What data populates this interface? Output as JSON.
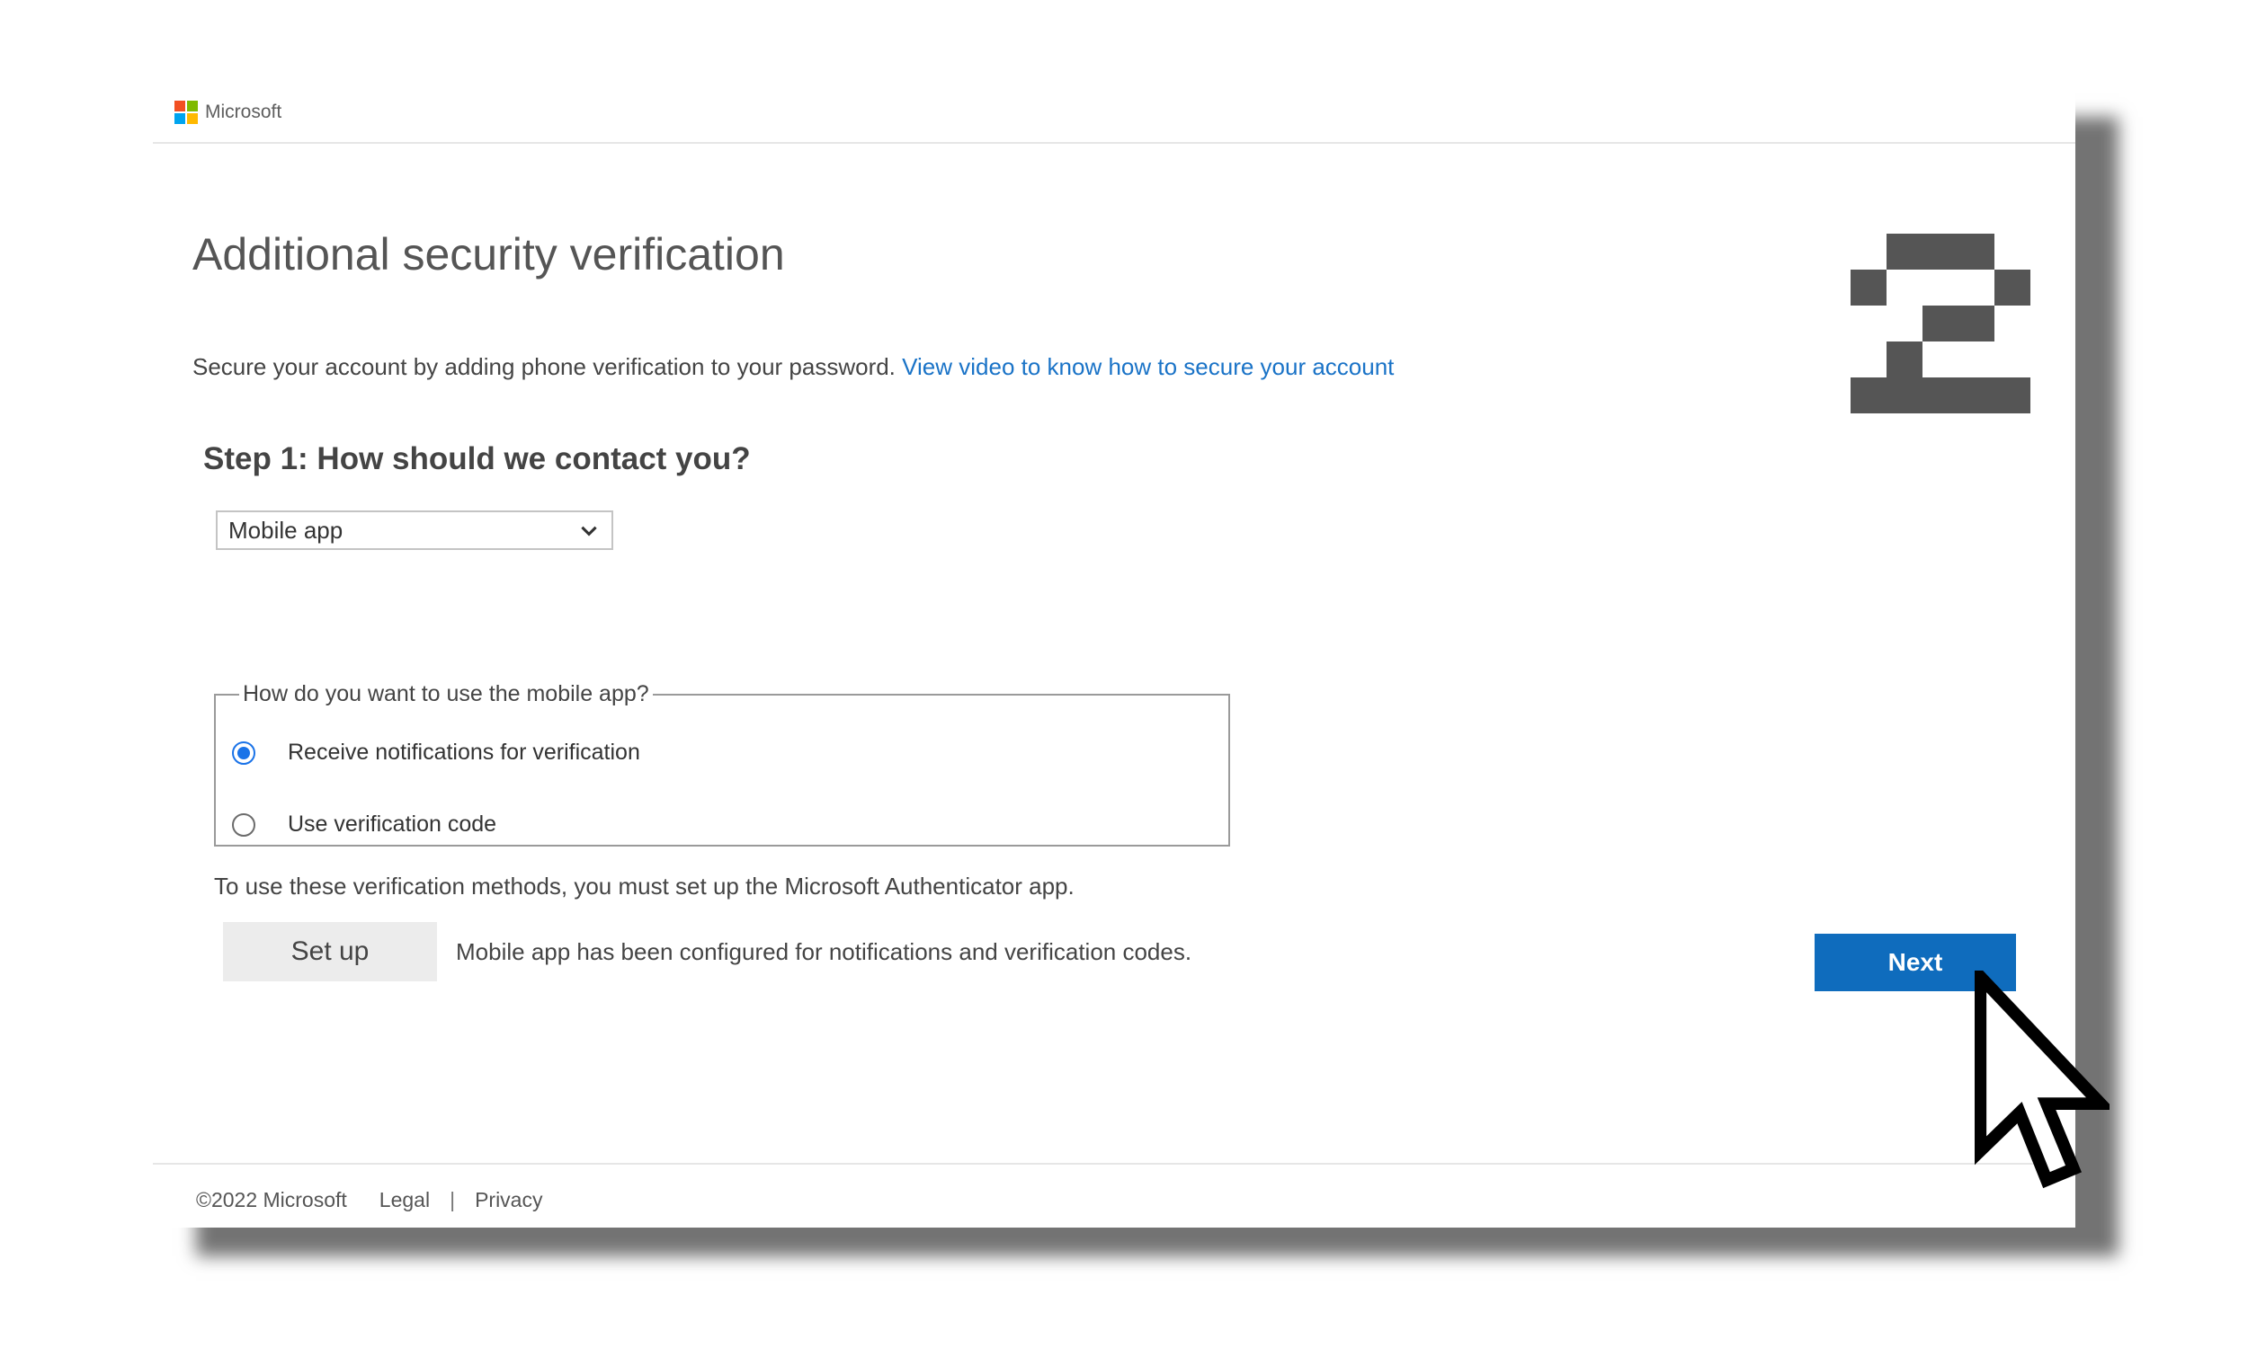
{
  "header": {
    "brand": "Microsoft",
    "logo_colors": [
      "#f25022",
      "#7fba00",
      "#00a4ef",
      "#ffb900"
    ]
  },
  "badge": {
    "number": "2"
  },
  "page": {
    "title": "Additional security verification",
    "intro_text": "Secure your account by adding phone verification to your password. ",
    "intro_link": "View video to know how to secure your account"
  },
  "step": {
    "title": "Step 1: How should we contact you?",
    "method_select": {
      "value": "Mobile app"
    }
  },
  "mobile_app": {
    "legend": "How do you want to use the mobile app?",
    "options": [
      {
        "label": "Receive notifications for verification",
        "selected": true
      },
      {
        "label": "Use verification code",
        "selected": false
      }
    ]
  },
  "setup": {
    "note": "To use these verification methods, you must set up the Microsoft Authenticator app.",
    "button_label": "Set up",
    "status": "Mobile app has been configured for notifications and verification codes."
  },
  "actions": {
    "next_label": "Next"
  },
  "footer": {
    "copyright": "©2022 Microsoft",
    "legal": "Legal",
    "separator": "|",
    "privacy": "Privacy"
  },
  "colors": {
    "accent": "#0f6cbd",
    "link": "#1a73c7",
    "radio_selected": "#1a73e8"
  },
  "icons": {
    "select_arrow": "chevron-down-icon",
    "pointer": "mouse-cursor-icon"
  }
}
